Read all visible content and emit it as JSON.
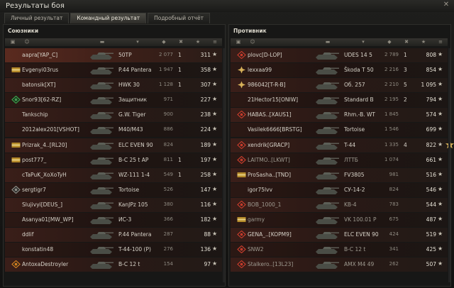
{
  "window": {
    "title": "Результаты боя"
  },
  "tabs": [
    {
      "label": "Личный результат",
      "active": false
    },
    {
      "label": "Командный результат",
      "active": true
    },
    {
      "label": "Подробный отчёт",
      "active": false
    }
  ],
  "colors": {
    "accent_row": "#5a2a1f",
    "row_red": "#3a1e19",
    "medal_gold": "#d8b25a"
  },
  "teams": {
    "allies": {
      "title": "Союзники",
      "rows": [
        {
          "player": "aapra[YAP_C]",
          "vehicle": "50TP",
          "damage": "2 077",
          "kills": "1",
          "xp": "311",
          "badge": "none",
          "highlight": true
        },
        {
          "player": "Evgenyi03rus",
          "vehicle": "P.44 Pantera",
          "damage": "1 947",
          "kills": "1",
          "xp": "358",
          "badge": "stripe-21"
        },
        {
          "player": "batonsik[XT]",
          "vehicle": "HWK 30",
          "damage": "1 128",
          "kills": "1",
          "xp": "307",
          "badge": "none"
        },
        {
          "player": "Snor93[62-RZ]",
          "vehicle": "Защитник",
          "damage": "971",
          "kills": "",
          "xp": "227",
          "badge": "diamond-green"
        },
        {
          "player": "Tankschip",
          "vehicle": "G.W. Tiger",
          "damage": "900",
          "kills": "",
          "xp": "238",
          "badge": "none"
        },
        {
          "player": "2012alex201[VSHOT]",
          "vehicle": "M40/M43",
          "damage": "886",
          "kills": "",
          "xp": "224",
          "badge": "none"
        },
        {
          "player": "Prizrak_4..[RL20]",
          "vehicle": "ELC EVEN 90",
          "damage": "824",
          "kills": "",
          "xp": "189",
          "badge": "stripe-32"
        },
        {
          "player": "post777_",
          "vehicle": "B-C 25 t AP",
          "damage": "811",
          "kills": "1",
          "xp": "197",
          "badge": "stripe-48"
        },
        {
          "player": "cTaPuK_XoXoTyH",
          "vehicle": "WZ-111 1-4",
          "damage": "549",
          "kills": "1",
          "xp": "258",
          "badge": "none"
        },
        {
          "player": "sergtigr7",
          "vehicle": "Tortoise",
          "damage": "526",
          "kills": "",
          "xp": "147",
          "badge": "diamond-gray"
        },
        {
          "player": "Slujivyi[DEUS_]",
          "vehicle": "KanJPz 105",
          "damage": "380",
          "kills": "",
          "xp": "116",
          "badge": "none"
        },
        {
          "player": "Asanya01[MW_WP]",
          "vehicle": "ИС-3",
          "damage": "366",
          "kills": "",
          "xp": "182",
          "badge": "none"
        },
        {
          "player": "ddlif",
          "vehicle": "P.44 Pantera",
          "damage": "287",
          "kills": "",
          "xp": "88",
          "badge": "none"
        },
        {
          "player": "konstatin48",
          "vehicle": "T-44-100 (P)",
          "damage": "276",
          "kills": "",
          "xp": "136",
          "badge": "none"
        },
        {
          "player": "AntoxaDestroyler",
          "vehicle": "B-C 12 t",
          "damage": "154",
          "kills": "",
          "xp": "97",
          "badge": "diamond-orange"
        }
      ]
    },
    "enemies": {
      "title": "Противник",
      "rows": [
        {
          "player": "plovc[D-LOP]",
          "vehicle": "UDES 14 5",
          "damage": "2 789",
          "kills": "1",
          "xp": "808",
          "badge": "diamond-red"
        },
        {
          "player": "lexxaa99",
          "vehicle": "Škoda T 50",
          "damage": "2 216",
          "kills": "3",
          "xp": "854",
          "badge": "cross-gold"
        },
        {
          "player": "986042[T-R-B]",
          "vehicle": "Об. 257",
          "damage": "2 210",
          "kills": "5",
          "xp": "1 095",
          "badge": "cross-gold"
        },
        {
          "player": "21Hector15[ONIW]",
          "vehicle": "Standard B",
          "damage": "2 195",
          "kills": "2",
          "xp": "794",
          "badge": "none"
        },
        {
          "player": "HABAS..[XAUS1]",
          "vehicle": "Rhm.-B. WT",
          "damage": "1 845",
          "kills": "",
          "xp": "574",
          "badge": "diamond-red"
        },
        {
          "player": "Vasilek6666[BRSTG]",
          "vehicle": "Tortoise",
          "damage": "1 546",
          "kills": "",
          "xp": "699",
          "badge": "none"
        },
        {
          "player": "xendrik[GRACP]",
          "vehicle": "T-44",
          "damage": "1 335",
          "kills": "4",
          "xp": "822",
          "badge": "diamond-red",
          "medal": true
        },
        {
          "player": "LAITMO..[LKWT]",
          "vehicle": "ЛТТБ",
          "damage": "1 074",
          "kills": "",
          "xp": "661",
          "badge": "diamond-red",
          "dead": true
        },
        {
          "player": "ProSasha..[TND]",
          "vehicle": "FV3805",
          "damage": "981",
          "kills": "",
          "xp": "516",
          "badge": "stripe-31"
        },
        {
          "player": "igor75lvv",
          "vehicle": "СУ-14-2",
          "damage": "824",
          "kills": "",
          "xp": "546",
          "badge": "none"
        },
        {
          "player": "BOB_1000_1",
          "vehicle": "KB-4",
          "damage": "783",
          "kills": "",
          "xp": "544",
          "badge": "diamond-red",
          "dead": true
        },
        {
          "player": "garmy",
          "vehicle": "VK 100.01 P",
          "damage": "675",
          "kills": "",
          "xp": "487",
          "badge": "stripe-33",
          "dead": true
        },
        {
          "player": "GENA_..[KOPM9]",
          "vehicle": "ELC EVEN 90",
          "damage": "424",
          "kills": "",
          "xp": "519",
          "badge": "diamond-red"
        },
        {
          "player": "SNW2",
          "vehicle": "B-C 12 t",
          "damage": "341",
          "kills": "",
          "xp": "425",
          "badge": "diamond-red",
          "dead": true
        },
        {
          "player": "Stalkero..[13L23]",
          "vehicle": "AMX M4 49",
          "damage": "262",
          "kills": "",
          "xp": "507",
          "badge": "diamond-red",
          "dead": true
        }
      ]
    }
  }
}
